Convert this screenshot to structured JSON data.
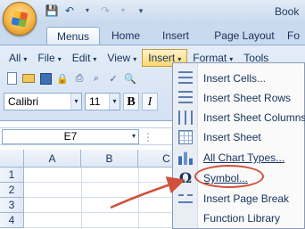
{
  "window": {
    "title": "Book"
  },
  "qat": {
    "save_icon": "save-icon",
    "undo_icon": "undo-icon",
    "redo_icon": "redo-icon"
  },
  "tabs": [
    {
      "label": "Menus",
      "active": true
    },
    {
      "label": "Home"
    },
    {
      "label": "Insert"
    },
    {
      "label": "Page Layout"
    },
    {
      "label": "Fo"
    }
  ],
  "menubar": [
    {
      "label": "All"
    },
    {
      "label": "File"
    },
    {
      "label": "Edit"
    },
    {
      "label": "View"
    },
    {
      "label": "Insert",
      "open": true
    },
    {
      "label": "Format"
    },
    {
      "label": "Tools"
    }
  ],
  "font": {
    "name": "Calibri",
    "size": "11",
    "bold": "B",
    "italic": "I"
  },
  "formula": {
    "namebox": "E7"
  },
  "grid": {
    "columns": [
      "A",
      "B",
      "C"
    ],
    "rows": [
      "1",
      "2",
      "3",
      "4"
    ]
  },
  "insert_menu": {
    "items": [
      {
        "label": "Insert Cells...",
        "icon": "insert-cells-icon"
      },
      {
        "label": "Insert Sheet Rows",
        "icon": "insert-rows-icon"
      },
      {
        "label": "Insert Sheet Columns",
        "icon": "insert-columns-icon"
      },
      {
        "label": "Insert Sheet",
        "icon": "insert-sheet-icon"
      },
      {
        "label": "All Chart Types...",
        "icon": "chart-icon"
      },
      {
        "label": "Symbol...",
        "icon": "omega-icon"
      },
      {
        "label": "Insert Page Break",
        "icon": "page-break-icon"
      },
      {
        "label": "Function Library",
        "icon": ""
      }
    ]
  },
  "colors": {
    "annotation": "#d0513a",
    "menu_open": "#ffd76f"
  }
}
